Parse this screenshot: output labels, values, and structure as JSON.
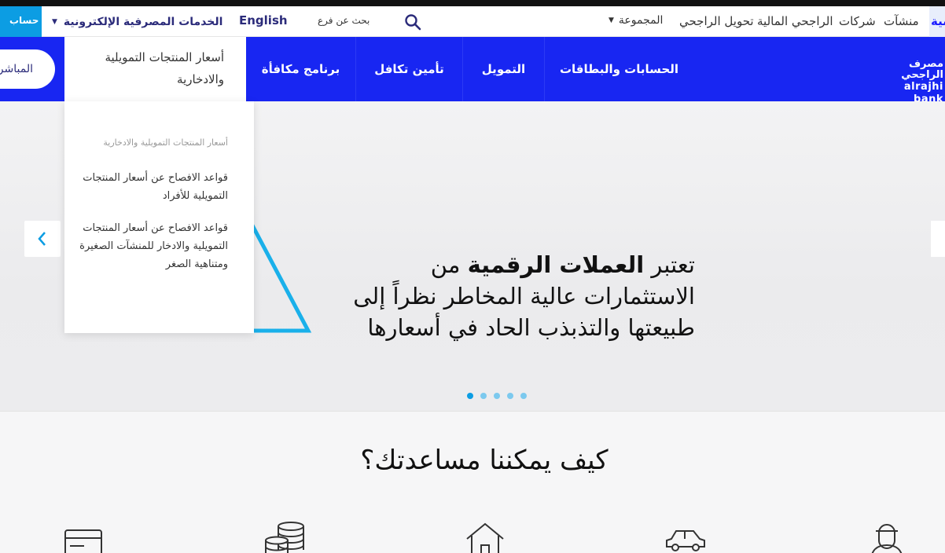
{
  "topbar": {
    "open_account": "فتح حساب",
    "ebanking": "الخدمات المصرفية الإلكترونية",
    "english": "English",
    "branch_search": "بحث عن فرع",
    "group": "المجموعة",
    "links": {
      "transfer": "تحويل الراجحي",
      "capital": "الراجحي المالية",
      "companies": "شركات",
      "firms": "منشآت",
      "personal": "شخصية"
    }
  },
  "nav": {
    "live": "المباشر",
    "active_tab": "أسعار المنتجات التمويلية والادخارية",
    "rewards": "برنامج مكافأة",
    "takaful": "تأمين تكافل",
    "finance": "التمويل",
    "accounts": "الحسابات والبطاقات"
  },
  "logo": {
    "arabic": "مصرف الراجحي",
    "english": "alrajhi bank"
  },
  "dropdown": {
    "heading": "أسعار المنتجات التمويلية والادخارية",
    "link1": "قواعد الافصاح عن أسعار المنتجات التمويلية للأفراد",
    "link2": "قواعد الافصاح عن أسعار المنتجات التمويلية والادخار للمنشآت الصغيرة ومتناهية الصغر"
  },
  "hero": {
    "line1_a": "تعتبر ",
    "line1_bold": "العملات الرقمية",
    "line1_b": " من",
    "line2": "الاستثمارات عالية المخاطر نظراً إلى",
    "line3": "طبيعتها والتذبذب الحاد في أسعارها",
    "slide_count": 5,
    "active_slide": 1
  },
  "help": {
    "title": "كيف يمكننا مساعدتك؟",
    "icons": [
      "card-icon",
      "coins-icon",
      "home-icon",
      "car-icon",
      "person-icon"
    ]
  },
  "colors": {
    "primary": "#1826f2",
    "accent": "#0c9de3",
    "dark_text": "#2b2b7a"
  }
}
